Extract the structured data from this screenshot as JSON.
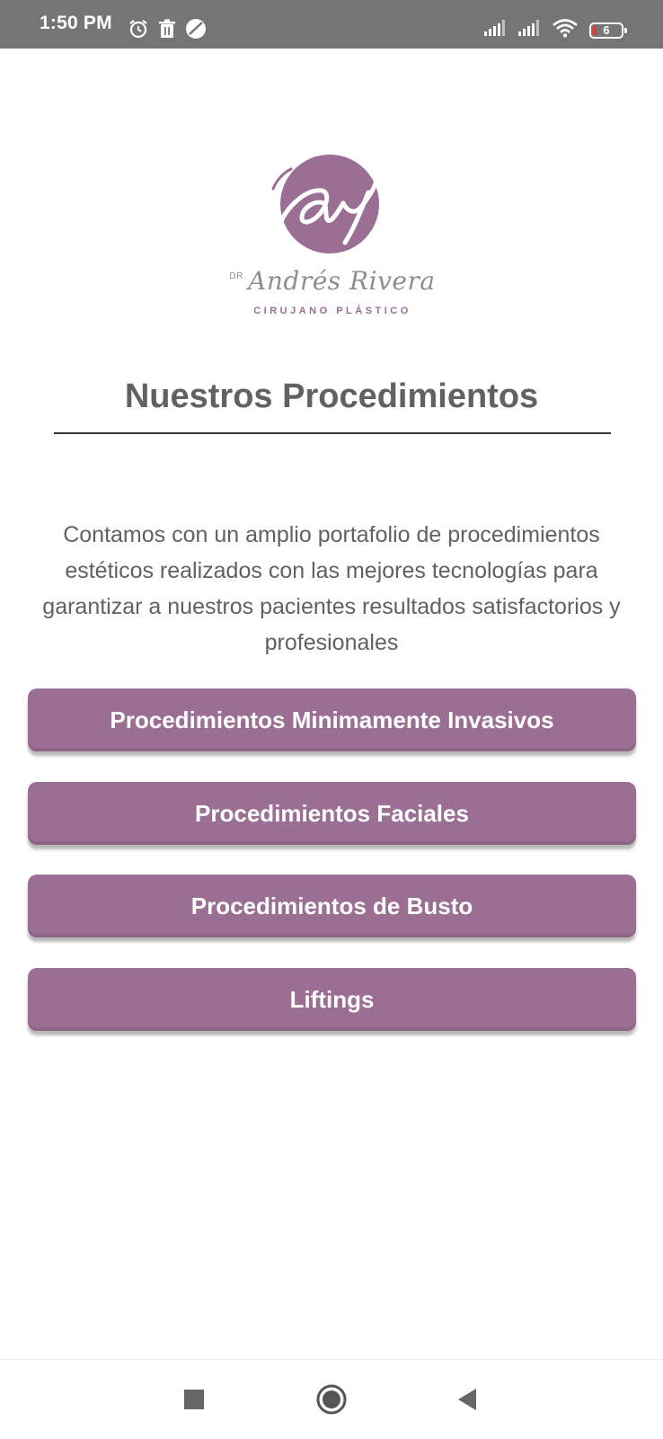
{
  "status_bar": {
    "time": "1:50 PM",
    "battery_level": "6",
    "icons": [
      "alarm-icon",
      "trash-icon",
      "blocked-icon",
      "signal-icon",
      "signal-icon",
      "wifi-icon",
      "battery-icon"
    ]
  },
  "logo": {
    "prefix": "DR.",
    "name": "Andrés Rivera",
    "subtitle": "CIRUJANO PLÁSTICO"
  },
  "page": {
    "title": "Nuestros Procedimientos",
    "description": "Contamos con un amplio portafolio de procedimientos estéticos realizados con las mejores tecnologías para garantizar a nuestros pacientes resultados satisfactorios y profesionales"
  },
  "buttons": [
    {
      "label": "Procedimientos Minimamente Invasivos"
    },
    {
      "label": "Procedimientos Faciales"
    },
    {
      "label": "Procedimientos de Busto"
    },
    {
      "label": "Liftings"
    }
  ],
  "colors": {
    "accent": "#9b6e93",
    "status_bar": "#757575",
    "text": "#616161"
  },
  "nav": {
    "icons": [
      "recents-icon",
      "home-icon",
      "back-icon"
    ]
  }
}
